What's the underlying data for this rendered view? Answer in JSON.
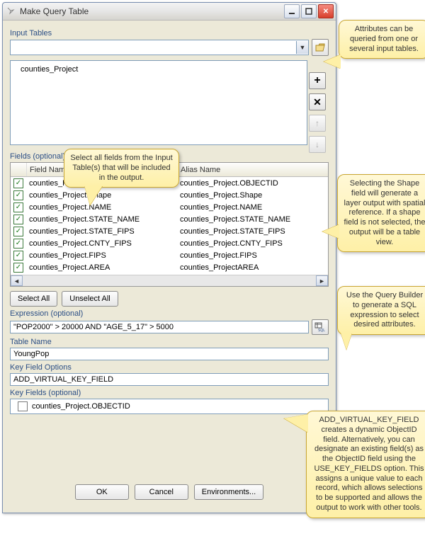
{
  "window": {
    "title": "Make Query Table"
  },
  "labels": {
    "input_tables": "Input Tables",
    "fields_optional": "Fields (optional)",
    "expression_optional": "Expression (optional)",
    "table_name": "Table Name",
    "key_field_options": "Key Field Options",
    "key_fields_optional": "Key Fields (optional)"
  },
  "input_tables": {
    "items": [
      "counties_Project"
    ]
  },
  "fields_grid": {
    "headers": {
      "field_name": "Field Name",
      "alias_name": "Alias Name"
    },
    "rows": [
      {
        "checked": true,
        "field": "counties_Project.OBJECTID",
        "alias": "counties_Project.OBJECTID"
      },
      {
        "checked": true,
        "field": "counties_Project.Shape",
        "alias": "counties_Project.Shape"
      },
      {
        "checked": true,
        "field": "counties_Project.NAME",
        "alias": "counties_Project.NAME"
      },
      {
        "checked": true,
        "field": "counties_Project.STATE_NAME",
        "alias": "counties_Project.STATE_NAME"
      },
      {
        "checked": true,
        "field": "counties_Project.STATE_FIPS",
        "alias": "counties_Project.STATE_FIPS"
      },
      {
        "checked": true,
        "field": "counties_Project.CNTY_FIPS",
        "alias": "counties_Project.CNTY_FIPS"
      },
      {
        "checked": true,
        "field": "counties_Project.FIPS",
        "alias": "counties_Project.FIPS"
      },
      {
        "checked": true,
        "field": "counties_Project.AREA",
        "alias": "counties_ProjectAREA"
      }
    ]
  },
  "buttons": {
    "select_all": "Select All",
    "unselect_all": "Unselect All",
    "ok": "OK",
    "cancel": "Cancel",
    "environments": "Environments..."
  },
  "expression": {
    "value": "\"POP2000\" > 20000 AND \"AGE_5_17\" > 5000"
  },
  "table_name": {
    "value": "YoungPop"
  },
  "key_field_options": {
    "value": "ADD_VIRTUAL_KEY_FIELD"
  },
  "key_fields": {
    "items": [
      {
        "checked": false,
        "label": "counties_Project.OBJECTID"
      }
    ]
  },
  "callouts": {
    "c1": "Attributes can be queried from one or several input tables.",
    "c2": "Select all fields from the Input Table(s) that will be included in the output.",
    "c3": "Selecting the Shape field will generate a layer output with spatial reference. If a shape field is not selected, the output will be a table view.",
    "c4": "Use the Query Builder to generate a SQL expression to select desired attributes.",
    "c5": "ADD_VIRTUAL_KEY_FIELD creates a dynamic ObjectID field.  Alternatively, you can designate an existing field(s) as the ObjectID field using the USE_KEY_FIELDS option. This assigns a unique value to each record, which allows selections to be supported and allows the output to work with other tools."
  },
  "sql_label": "SQL"
}
